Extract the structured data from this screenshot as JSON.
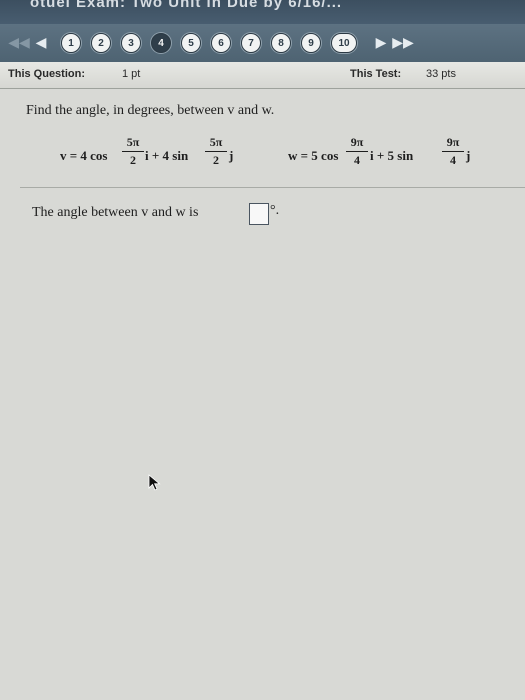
{
  "header": {
    "title_fragment": "otuel Exam: Two Unit in Due by 6/16/..."
  },
  "nav": {
    "first_label": "◀◀",
    "prev_label": "◀",
    "next_label": "▶",
    "last_label": "▶▶",
    "questions": [
      "1",
      "2",
      "3",
      "4",
      "5",
      "6",
      "7",
      "8",
      "9",
      "10"
    ],
    "current": "4"
  },
  "info": {
    "question_label": "This Question:",
    "question_value": "1 pt",
    "test_label": "This Test:",
    "test_value": "33 pts"
  },
  "question": {
    "prompt": "Find the angle, in degrees, between v and w.",
    "v_lhs": "v = 4 cos",
    "v_mid": "i + 4 sin",
    "v_end": "j",
    "v_frac1_num": "5π",
    "v_frac1_den": "2",
    "v_frac2_num": "5π",
    "v_frac2_den": "2",
    "w_lhs": "w = 5 cos",
    "w_mid": "i + 5 sin",
    "w_end": "j",
    "w_frac1_num": "9π",
    "w_frac1_den": "4",
    "w_frac2_num": "9π",
    "w_frac2_den": "4",
    "answer_prefix": "The angle between v and w is",
    "answer_value": "",
    "answer_suffix": "°."
  }
}
